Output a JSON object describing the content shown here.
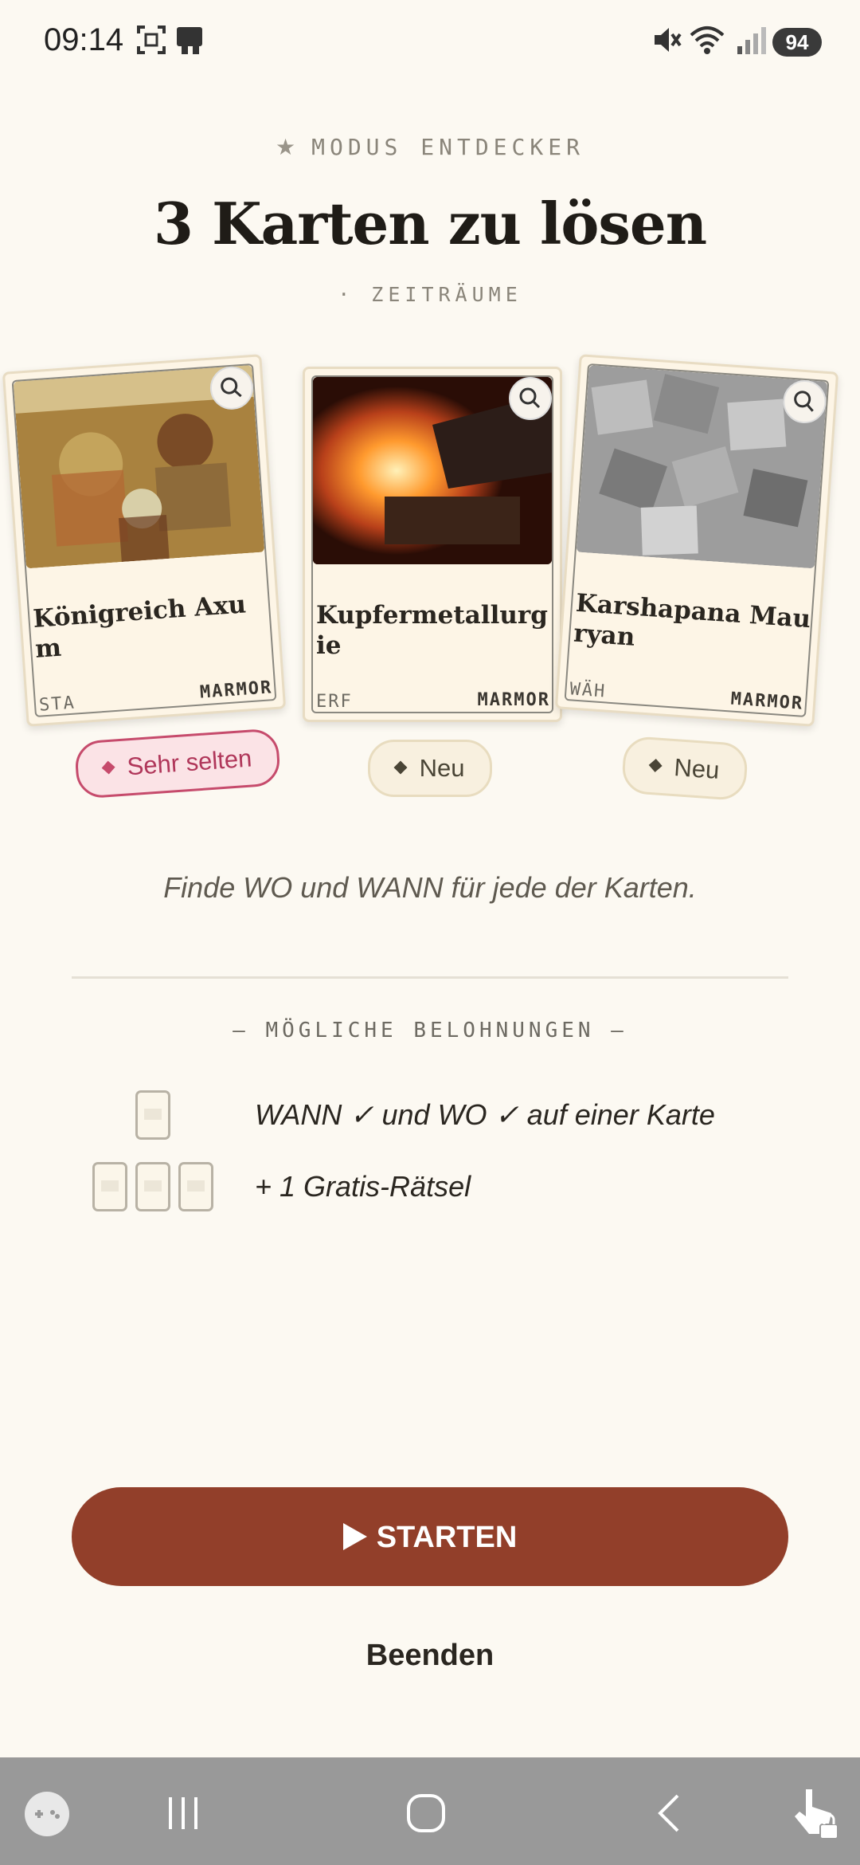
{
  "status_bar": {
    "time": "09:14",
    "battery": "94",
    "icons": [
      "screenshot-icon",
      "device-icon",
      "mute-icon",
      "wifi-icon",
      "signal-icon"
    ]
  },
  "header": {
    "mode_label": "MODUS ENTDECKER",
    "title": "3 Karten zu lösen",
    "subtitle": "· ZEITRÄUME"
  },
  "cards": [
    {
      "title": "Königreich Axum",
      "code": "STA",
      "material": "MARMOR",
      "badge": "Sehr selten",
      "badge_kind": "rare"
    },
    {
      "title": "Kupfermetallurgie",
      "code": "ERF",
      "material": "MARMOR",
      "badge": "Neu",
      "badge_kind": "new"
    },
    {
      "title": "Karshapana Mauryan",
      "code": "WÄH",
      "material": "MARMOR",
      "badge": "Neu",
      "badge_kind": "new"
    }
  ],
  "instruction": "Finde WO und WANN für jede der Karten.",
  "rewards": {
    "heading": "— MÖGLICHE BELOHNUNGEN —",
    "items": [
      {
        "text": "WANN ✓ und WO ✓ auf einer Karte",
        "card_count": 1
      },
      {
        "text": "+ 1 Gratis-Rätsel",
        "card_count": 3
      }
    ]
  },
  "actions": {
    "start_label": "STARTEN",
    "quit_label": "Beenden"
  },
  "colors": {
    "background": "#fcf9f2",
    "start_button": "#923f2a",
    "rare_badge": "#c64b6c",
    "nav_bar": "#999999"
  }
}
